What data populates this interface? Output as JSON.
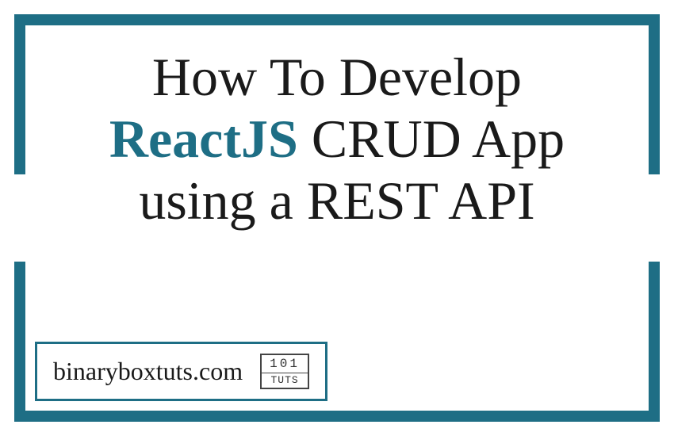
{
  "title": {
    "line1_prefix": "How To Develop",
    "line2_highlight": "ReactJS",
    "line2_suffix": " CRUD App",
    "line3": "using a REST API"
  },
  "footer": {
    "site": "binaryboxtuts.com",
    "logo_top": "101",
    "logo_bottom": "TUTS"
  },
  "colors": {
    "accent": "#1e6e85",
    "text": "#1a1a1a"
  }
}
